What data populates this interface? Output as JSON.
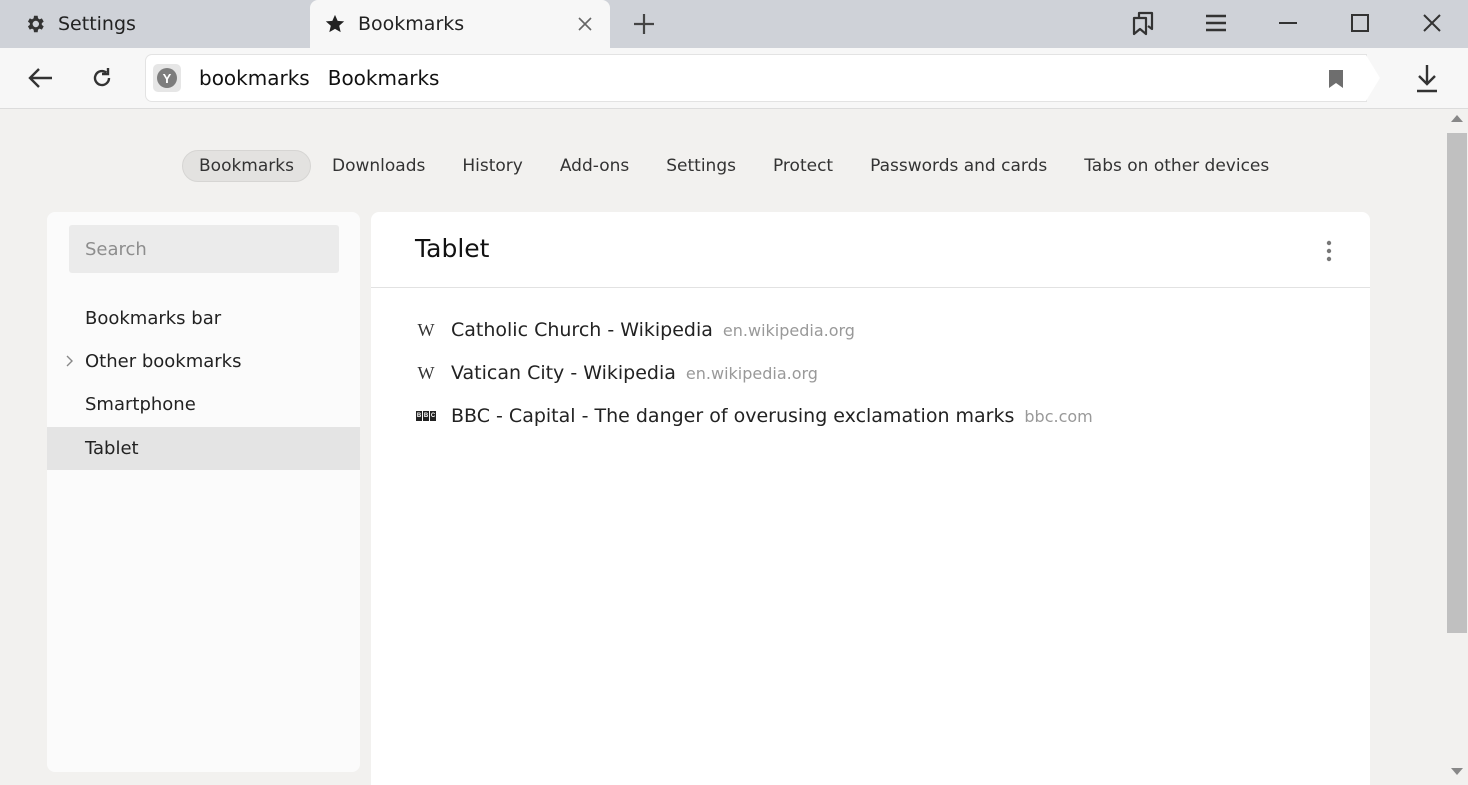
{
  "tabs": [
    {
      "label": "Settings",
      "icon": "gear-icon"
    },
    {
      "label": "Bookmarks",
      "icon": "star-icon",
      "active": true
    }
  ],
  "address_bar": {
    "domain": "bookmarks",
    "page_title": "Bookmarks"
  },
  "top_nav": {
    "items": [
      "Bookmarks",
      "Downloads",
      "History",
      "Add-ons",
      "Settings",
      "Protect",
      "Passwords and cards",
      "Tabs on other devices"
    ],
    "active": "Bookmarks"
  },
  "sidebar": {
    "search_placeholder": "Search",
    "folders": [
      {
        "label": "Bookmarks bar"
      },
      {
        "label": "Other bookmarks",
        "expandable": true
      },
      {
        "label": "Smartphone"
      },
      {
        "label": "Tablet",
        "selected": true
      }
    ]
  },
  "main": {
    "title": "Tablet",
    "bookmarks": [
      {
        "title": "Catholic Church - Wikipedia",
        "domain": "en.wikipedia.org",
        "favicon": "wikipedia-icon",
        "favicon_text": "W"
      },
      {
        "title": "Vatican City - Wikipedia",
        "domain": "en.wikipedia.org",
        "favicon": "wikipedia-icon",
        "favicon_text": "W"
      },
      {
        "title": "BBC - Capital - The danger of overusing exclamation marks",
        "domain": "bbc.com",
        "favicon": "bbc-icon",
        "favicon_letters": [
          "B",
          "B",
          "C"
        ]
      }
    ]
  }
}
